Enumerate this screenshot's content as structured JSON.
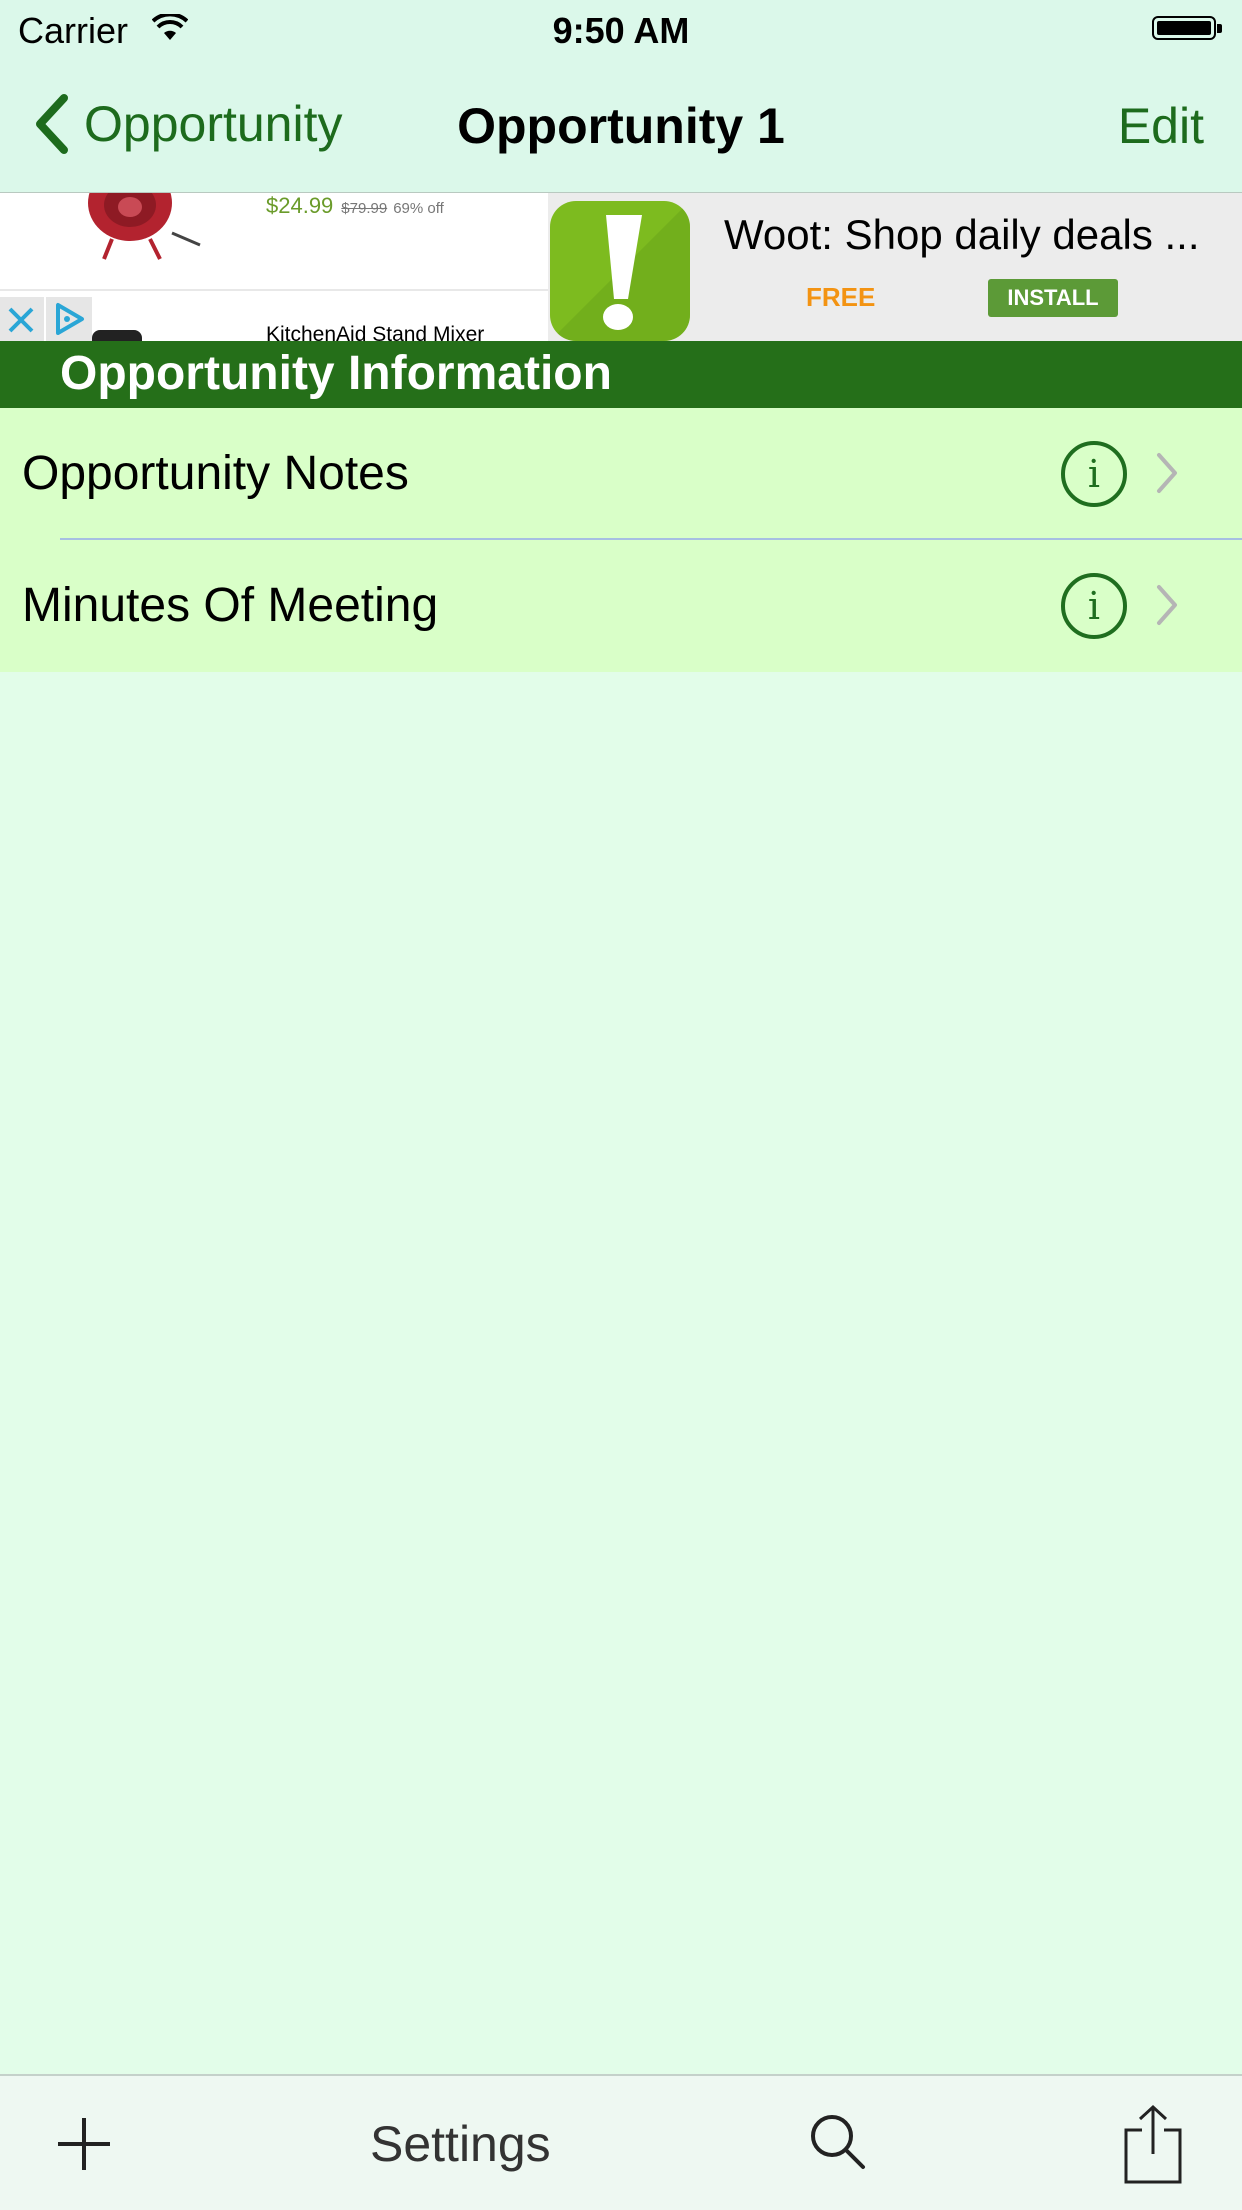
{
  "status_bar": {
    "carrier": "Carrier",
    "time": "9:50 AM"
  },
  "nav": {
    "back_label": "Opportunity",
    "title": "Opportunity 1",
    "edit_label": "Edit"
  },
  "ad": {
    "price": "$24.99",
    "old_price": "$79.99",
    "discount": "69% off",
    "product2": "KitchenAid Stand Mixer",
    "headline": "Woot: Shop daily deals ...",
    "free_label": "FREE",
    "install_label": "INSTALL"
  },
  "section": {
    "title": "Opportunity Information"
  },
  "rows": [
    {
      "label": "Opportunity Notes"
    },
    {
      "label": "Minutes Of Meeting"
    }
  ],
  "toolbar": {
    "settings_label": "Settings"
  },
  "colors": {
    "accent": "#1d6b1d",
    "header_bg": "#256f19",
    "row_bg": "#d9ffc8",
    "page_bg": "#e2fde9"
  }
}
